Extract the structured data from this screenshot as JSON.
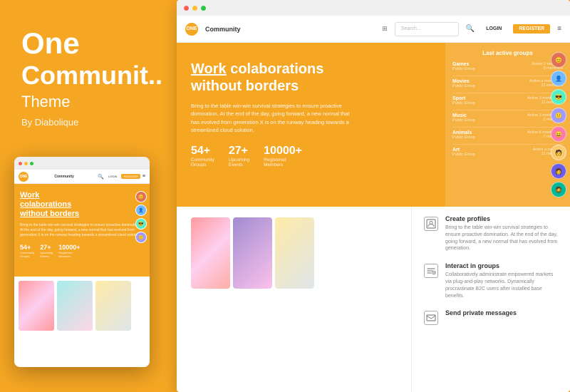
{
  "left": {
    "title": "One",
    "subtitle": "Communit..",
    "theme_label": "Theme",
    "by_label": "By Diabolique"
  },
  "browser_dots": {
    "red": "#ff5f57",
    "yellow": "#ffbd2e",
    "green": "#28c840"
  },
  "nav": {
    "logo_text": "ONE",
    "brand": "Community",
    "search_placeholder": "Search...",
    "login": "LOGIN",
    "register": "REGISTER"
  },
  "hero": {
    "title_bold": "Work",
    "title_underline": "colaborations",
    "title_rest": "without borders",
    "description": "Bring to the table win-win survival strategies to ensure proactive domination. At the end of the day, going forward, a new normal that has evolved from generation X is on the runway heading towards a streamlined cloud solution.",
    "stats": [
      {
        "number": "54+",
        "label1": "Community",
        "label2": "Groups"
      },
      {
        "number": "27+",
        "label1": "Upcoming",
        "label2": "Events"
      },
      {
        "number": "10000+",
        "label1": "Registered",
        "label2": "Members"
      }
    ]
  },
  "groups_panel": {
    "title": "Last active groups",
    "groups": [
      {
        "name": "Games",
        "type": "Public Group",
        "active": "Active 2 days ago",
        "members": "3 members"
      },
      {
        "name": "Movies",
        "type": "Public Group",
        "active": "Active a month ago",
        "members": "13 members"
      },
      {
        "name": "Sport",
        "type": "Public Group",
        "active": "Active 3 months ago",
        "members": "11 members"
      },
      {
        "name": "Music",
        "type": "Public Group",
        "active": "Active 3 months ago",
        "members": "2 members"
      },
      {
        "name": "Animals",
        "type": "Public Group",
        "active": "Active 6 months ago",
        "members": "7 members"
      },
      {
        "name": "Art",
        "type": "Public Group",
        "active": "Active a year ago",
        "members": "11 members"
      }
    ]
  },
  "features": [
    {
      "icon": "👤",
      "title": "Create profiles",
      "desc": "Bring to the table win-win survival strategies to ensure proactive domination. At the end of the day, going forward, a new normal that has evolved from generation."
    },
    {
      "icon": "⚡",
      "title": "Interact in groups",
      "desc": "Collaboratively administrate empowered markets via plug-and-play networks. Dynamically procrastinate B2C users after installed base benefits."
    },
    {
      "icon": "✉",
      "title": "Send private messages",
      "desc": ""
    }
  ]
}
